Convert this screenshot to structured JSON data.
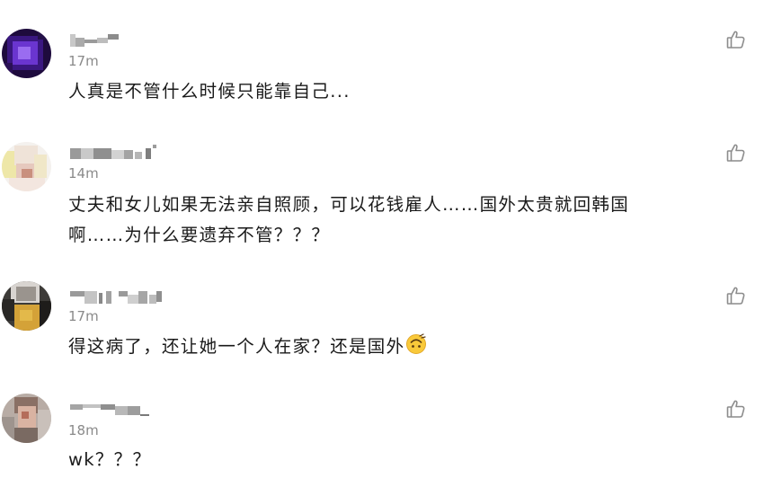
{
  "comments": [
    {
      "time": "17m",
      "text": "人真是不管什么时候只能靠自己..."
    },
    {
      "time": "14m",
      "text_line1": "丈夫和女儿如果无法亲自照顾，可以花钱雇人……国外太贵就回韩国",
      "text_line2": "啊……为什么要遗弃不管？？？"
    },
    {
      "time": "17m",
      "text": "得这病了，还让她一个人在家？还是国外"
    },
    {
      "time": "18m",
      "text": "wk？？？"
    }
  ],
  "icons": {
    "like": "thumbs-up-icon",
    "emoji": "upside-down-smile-emoji"
  },
  "colors": {
    "text": "#1a1a1a",
    "time": "#8a8a8a",
    "icon": "#8c8c8c"
  }
}
